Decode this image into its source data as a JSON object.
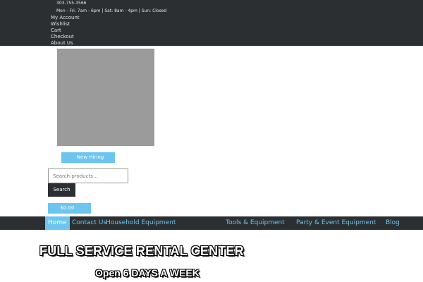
{
  "topbar": {
    "phone_icon": "",
    "phone": "303-755-3566",
    "hours": "Mon - Fri: 7am - 6pm | Sat: 8am - 4pm | Sun: Closed",
    "links": [
      "My Account",
      "Wishlist",
      "Cart",
      "Checkout",
      "About Us"
    ]
  },
  "hiring": {
    "icon": "",
    "label": "New Hiring"
  },
  "search": {
    "placeholder": "Search products…",
    "button_label": "Search"
  },
  "cart": {
    "total": "$0.00",
    "icon": ""
  },
  "nav": {
    "items": [
      {
        "label": "Home",
        "dropdown": ""
      },
      {
        "label": "Contact Us",
        "dropdown": ""
      },
      {
        "label": "Household Equipment",
        "dropdown": ""
      },
      {
        "label": "Tools & Equipment",
        "dropdown": ""
      },
      {
        "label": "Party & Event Equipment",
        "dropdown": ""
      },
      {
        "label": "Blog",
        "dropdown": ""
      }
    ]
  },
  "hero": {
    "title": "FULL SERVICE RENTAL CENTER",
    "subtitle": "Open 6 DAYS A WEEK"
  },
  "colors": {
    "dark_bar": "#2b2f31",
    "accent": "#6cc5ef",
    "logo_placeholder": "#9b9b9b"
  }
}
